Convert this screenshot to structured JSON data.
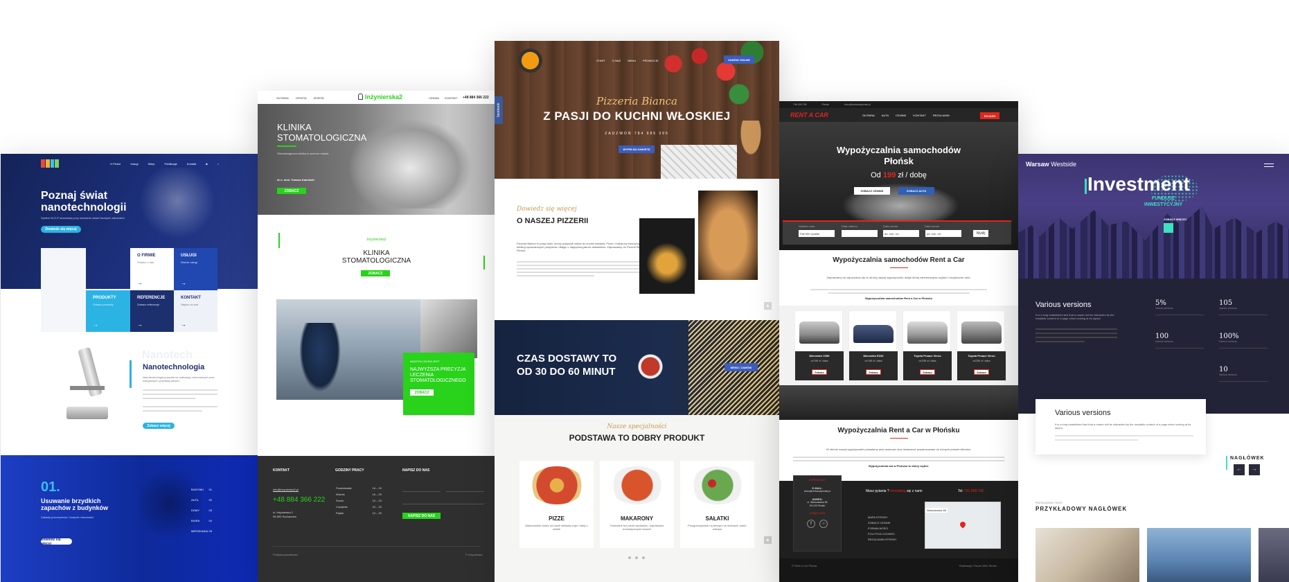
{
  "nano": {
    "logo": "nanotech logo",
    "nav": [
      "O Firmie",
      "Usługi",
      "Sklep",
      "Publikacje",
      "Kontakt"
    ],
    "hero_title": "Poznaj świat nanotechnologii",
    "hero_sub": "System M-O-P stosowany przy usuwaniu nawet trudnych zabrudzeń",
    "hero_btn": "Dowiedz się więcej",
    "tiles": [
      {
        "title": "O FIRMIE",
        "desc": "Zobacz o nas"
      },
      {
        "title": "USŁUGI",
        "desc": "Ważne usługi"
      },
      {
        "title": "PRODUKTY",
        "desc": "Zobacz produkty"
      },
      {
        "title": "REFERENCJE",
        "desc": "Zobacz referencje"
      },
      {
        "title": "KONTAKT",
        "desc": "Napisz do nas"
      }
    ],
    "section_ghost": "Nanotech",
    "section_title": "Nanotechnologia",
    "section_side": "nanotechnologia",
    "section_text": "Nanotechnologia pozwala na realizację różnorodnych prac usługowych i poprawę jakości.",
    "section_btn": "Zobacz więcej",
    "num": "01.",
    "num_title": "Usuwanie brzydkich zapachów z budynków",
    "num_text": "Zakłady przemysłowe i budynki mieszkalne",
    "num_btn": "Dowiedz się więcej",
    "num_list": [
      "BUDYNKI",
      "AUTA",
      "DOMY",
      "BIURA",
      "MIESZKANIA"
    ],
    "num_list_vals": [
      "01",
      "02",
      "03",
      "04",
      "05"
    ]
  },
  "dental": {
    "nav_left": [
      "GŁÓWNA",
      "OFERTA",
      "ZESPÓŁ"
    ],
    "logo": "Inżynierska2",
    "nav_right": [
      "CENNIK",
      "KONTAKT"
    ],
    "phone": "+48 884 366 222",
    "hero_title_1": "KLINIKA",
    "hero_title_2": "STOMATOLOGICZNA",
    "hero_text": "Stomatologiczna klinika w centrum miasta",
    "hero_doc": "dr n. med. Tomasz Kamiński",
    "hero_btn": "ZOBACZ",
    "sec_small": "Inżynierska2",
    "sec_title_1": "KLINIKA",
    "sec_title_2": "STOMATOLOGICZNA",
    "sec_btn": "ZOBACZ",
    "green_small": "NASZYM CELEM JEST",
    "green_title": "NAJWYŻSZA PRECYZJA LECZENIA STOMATOLOGICZNEGO",
    "green_btn": "ZOBACZ",
    "foot_h1": "KONTAKT",
    "foot_email": "info@inzynierska2.pl",
    "foot_phone": "+48 884 366 222",
    "foot_addr": "ul. Inżynierska 2",
    "foot_city": "96-500 Sochaczew",
    "foot_h2": "GODZINY PRACY",
    "days": [
      "Poniedziałek",
      "Wtorek",
      "Środa",
      "Czwartek",
      "Piątek"
    ],
    "hours": [
      "16 – 20",
      "16 – 20",
      "10 – 20",
      "10 – 20",
      "10 – 20"
    ],
    "foot_h3": "NAPISZ DO NAS",
    "foot_btn": "NAPISZ DO NAS",
    "foot_copy": "Polityka prywatności",
    "foot_right": "© Inżynierska"
  },
  "pizza": {
    "nav": [
      "START",
      "O NAS",
      "MENU",
      "PROMOCJE"
    ],
    "order_btn": "ZAMÓW ONLINE",
    "facebook": "facebook",
    "script_name": "Pizzeria Bianca",
    "hero_title": "Z PASJI DO KUCHNI WŁOSKIEJ",
    "hero_phone": "ZADZWOŃ 784 985 395",
    "hero_btn": "WYPEŁNIJ ANKIETĘ",
    "about_script": "Dowiedz się więcej",
    "about_title": "O NASZEJ PIZZERII",
    "about_text": "Pizzeria Bianca to pasja ludzi, którzy połączyli miłość do kuchni włoskiej. Pizze i makarony tworzymy według sprawdzonych przepisów, dbając o najwyższą jakość składników. Zapraszamy do Pizzerii Bianca Płońsk.",
    "delivery_1": "CZAS DOSTAWY TO",
    "delivery_2": "OD 30 DO 60 MINUT",
    "delivery_btn": "MENU / ZAMÓW",
    "spec_script": "Nasze specjalności",
    "spec_title": "PODSTAWA TO DOBRY PRODUKT",
    "products": [
      {
        "name": "PIZZE",
        "desc": "Mistrzowskie ciasto na bazie włoskiej mąki i oliwy z oliwek"
      },
      {
        "name": "MAKARONY",
        "desc": "Gotowane tuż przed wydaniem, doprawione aromatycznymi sosami"
      },
      {
        "name": "SAŁATKI",
        "desc": "Przygotowywane na bieżąco ze świeżych sałat i warzyw"
      }
    ]
  },
  "rent": {
    "topbar": [
      "796 909 799",
      "Płońsk",
      "biuro@rentacarplonsk.pl"
    ],
    "logo": "RENT A CAR",
    "nav": [
      "GŁÓWNA",
      "AUTA",
      "CENNIK",
      "KONTAKT",
      "REGULAMIN"
    ],
    "nav_btn": "DOJAZD",
    "hero_title_1": "Wypożyczalnia samochodów",
    "hero_title_2": "Płońsk",
    "hero_price_pre": "Od",
    "hero_price": "199",
    "hero_price_post": "zł / dobę",
    "hero_btn1": "ZOBACZ CENNIK",
    "hero_btn2": "ZOBACZ AUTA",
    "form_labels": [
      "Wybierz auto",
      "Data odbioru",
      "Data zwrotu",
      "Data zwrotu"
    ],
    "form_vals": [
      "Fiat 500 Qualité",
      "",
      "dd. mm. rrrr",
      "dd. mm. rrrr"
    ],
    "form_btn": "Wyślij",
    "sec_title": "Wypożyczalnia samochodów Rent a Car",
    "sec_text": "Zapraszamy do zapoznania się ze stroną naszej wypożyczalni, dzięki której zarezerwujesz szybko i bezpiecznie auto.",
    "sec_bold": "Wypożyczalnia samochodów Rent a Car w Płońsku",
    "cars": [
      {
        "name": "Mercedes V250",
        "price": "od 299 zł / doba",
        "btn": "Zobacz"
      },
      {
        "name": "Mercedes E220",
        "price": "od 199 zł / doba",
        "btn": "Zobacz"
      },
      {
        "name": "Toyota Proace Verso",
        "price": "od 299 zł / doba",
        "btn": "Zobacz"
      },
      {
        "name": "Toyota Proace Verso",
        "price": "od 259 zł / doba",
        "btn": "Zobacz"
      }
    ],
    "sec2_title": "Wypożyczalnia Rent a Car w Płońsku",
    "sec2_text": "W ofercie naszej wypożyczalni posiadamy auta osobowe oraz dostawcze przystosowane do różnych potrzeb klientów.",
    "sec2_bold": "Wypożyczalnia aut w Płońsku to dobry wybór.",
    "foot_q_pre": "Masz pytania ?",
    "foot_q_red": "skontaktuj",
    "foot_q_post": "się z nami",
    "foot_tel_label": "Tel:",
    "foot_tel": "791 908 766",
    "foot_links": [
      "MAPA STRONY",
      "ZOBACZ CENNIK",
      "FORMALNOŚCI",
      "POLITYKA COOKIES",
      "REGULAMIN STRONY"
    ],
    "foot_card": [
      "ZAPRASZAMY",
      "E-MAIL:",
      "biuro@rentacarplonsk.pl",
      "ADRES:",
      "ul. Warszawska 80",
      "09-100 Płońsk",
      "ZOBACZ NAS"
    ],
    "map_label": "Warszawska 80",
    "copy_left": "© Rent A Car Płońsk",
    "copy_right": "Realizacja: Future Web Studio"
  },
  "invest": {
    "logo_bold": "Warsaw",
    "logo_light": "Westside",
    "hero_title": "Investment",
    "hero_sub_1": "FUNDUSZ",
    "hero_sub_2": "INWESTYCYJNY",
    "hero_btn": "ZOBACZ WIĘCEJ",
    "sec_title": "Various versions",
    "sec_text": "It is a long established fact that a reader will be distracted by the readable content of a page when looking at its layout.",
    "stats": [
      {
        "val": "5%",
        "label": "Various versions"
      },
      {
        "val": "105",
        "label": "Various versions"
      },
      {
        "val": "100",
        "label": "Various versions"
      },
      {
        "val": "100%",
        "label": "Various versions"
      },
      {
        "val": "10",
        "label": "Various versions"
      }
    ],
    "card_title": "Various versions",
    "card_text": "It is a long established fact that a reader will be distracted by the readable content of a page when looking at its layout.",
    "naglowek": "NAGŁÓWEK",
    "small_label": "PRZYKŁADOWY TEKST",
    "big_label": "PRZYKŁADOWY NAGŁÓWEK"
  },
  "colors": {
    "nano_blue": "#1c2f6e",
    "nano_cyan": "#2bb3e3",
    "dental_green": "#29d21b",
    "pizza_red": "#c0392b",
    "rent_red": "#e1261c",
    "invest_purple": "#2a2450",
    "invest_teal": "#3de0c0"
  }
}
